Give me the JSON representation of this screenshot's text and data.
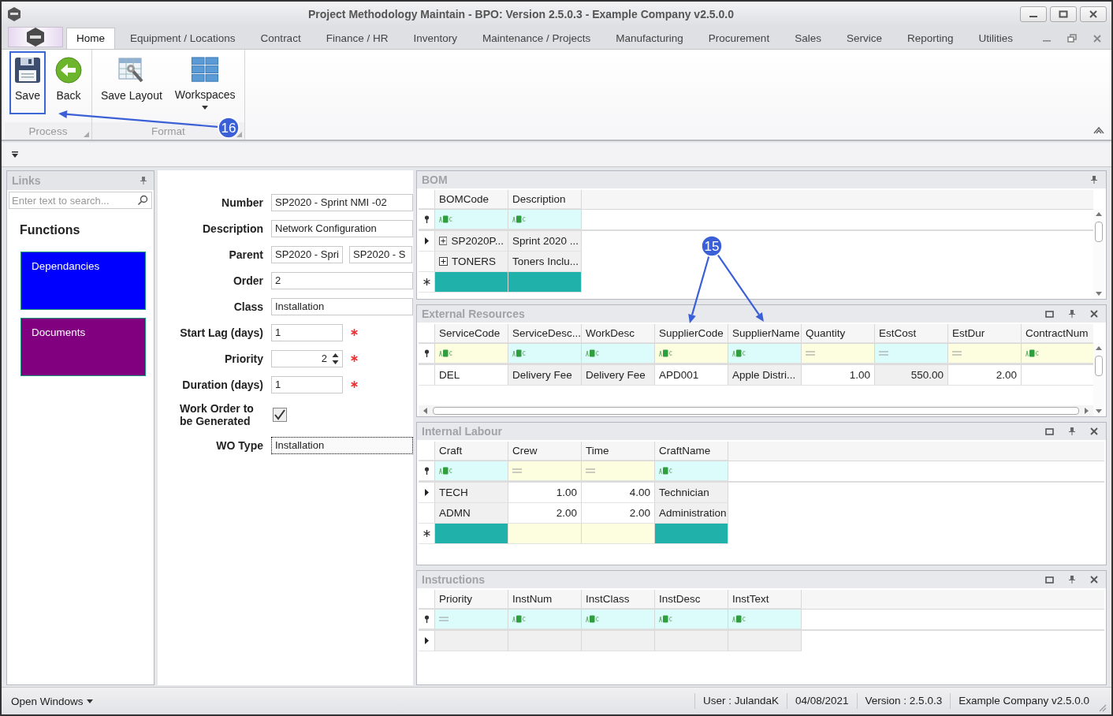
{
  "window": {
    "title": "Project Methodology Maintain - BPO: Version 2.5.0.3 - Example Company v2.5.0.0"
  },
  "tabs": [
    {
      "label": "Home",
      "selected": true
    },
    {
      "label": "Equipment / Locations",
      "selected": false
    },
    {
      "label": "Contract",
      "selected": false
    },
    {
      "label": "Finance / HR",
      "selected": false
    },
    {
      "label": "Inventory",
      "selected": false
    },
    {
      "label": "Maintenance / Projects",
      "selected": false
    },
    {
      "label": "Manufacturing",
      "selected": false
    },
    {
      "label": "Procurement",
      "selected": false
    },
    {
      "label": "Sales",
      "selected": false
    },
    {
      "label": "Service",
      "selected": false
    },
    {
      "label": "Reporting",
      "selected": false
    },
    {
      "label": "Utilities",
      "selected": false
    }
  ],
  "ribbon": {
    "groups": [
      {
        "label": "Process",
        "buttons": [
          {
            "label": "Save",
            "kind": "save",
            "highlighted": true,
            "dropdown": false
          },
          {
            "label": "Back",
            "kind": "back",
            "highlighted": false,
            "dropdown": false
          }
        ]
      },
      {
        "label": "Format",
        "buttons": [
          {
            "label": "Save Layout",
            "kind": "layout",
            "highlighted": false,
            "dropdown": false
          },
          {
            "label": "Workspaces",
            "kind": "workspaces",
            "highlighted": false,
            "dropdown": true
          }
        ]
      }
    ]
  },
  "links": {
    "title": "Links",
    "search": {
      "placeholder": "Enter text to search..."
    },
    "heading": "Functions",
    "items": [
      {
        "label": "Dependancies",
        "color": "#0000ff"
      },
      {
        "label": "Documents",
        "color": "#800080"
      }
    ]
  },
  "form": {
    "fields": [
      {
        "label": "Number",
        "kind": "text",
        "value": "SP2020 - Sprint NMI -02",
        "focused": false
      },
      {
        "label": "Description",
        "kind": "text",
        "value": "Network Configuration",
        "focused": false
      },
      {
        "label": "Parent",
        "kind": "pair",
        "values": [
          "SP2020 - Spri",
          "SP2020 - S"
        ],
        "focused": false
      },
      {
        "label": "Order",
        "kind": "text",
        "value": "2",
        "focused": false
      },
      {
        "label": "Class",
        "kind": "text",
        "value": "Installation",
        "focused": false
      },
      {
        "label": "Start Lag (days)",
        "kind": "number",
        "value": "1",
        "required": true,
        "focused": false
      },
      {
        "label": "Priority",
        "kind": "spin",
        "value": "2",
        "required": true,
        "focused": false
      },
      {
        "label": "Duration (days)",
        "kind": "number",
        "value": "1",
        "required": true,
        "focused": false
      },
      {
        "label": "Work Order to be Generated",
        "kind": "check",
        "checked": true
      },
      {
        "label": "WO Type",
        "kind": "text",
        "value": "Installation",
        "focused": true
      }
    ]
  },
  "panels": [
    {
      "title": "BOM",
      "controls": [
        {
          "kind": "pin"
        }
      ],
      "vertical_scroll": true,
      "horizontal_scroll": false,
      "new_row": true,
      "columns": [
        {
          "label": "BOMCode",
          "kind": "text",
          "color": "#dcfbfb",
          "editable": false
        },
        {
          "label": "Description",
          "kind": "text",
          "color": "#dcfbfb",
          "editable": false
        }
      ],
      "rows": [
        {
          "current": true,
          "expandable": true,
          "cells": [
            "SP2020P...",
            "Sprint 2020 ..."
          ]
        },
        {
          "current": false,
          "expandable": true,
          "cells": [
            "TONERS",
            "Toners Inclu..."
          ]
        }
      ]
    },
    {
      "title": "External Resources",
      "controls": [
        {
          "kind": "restore"
        },
        {
          "kind": "pin"
        },
        {
          "kind": "close"
        }
      ],
      "vertical_scroll": true,
      "horizontal_scroll": true,
      "new_row": false,
      "columns": [
        {
          "label": "ServiceCode",
          "kind": "text",
          "color": "#fdfde0",
          "editable": true
        },
        {
          "label": "ServiceDesc...",
          "kind": "text",
          "color": "#dcfbfb",
          "editable": false
        },
        {
          "label": "WorkDesc",
          "kind": "text",
          "color": "#dcfbfb",
          "editable": false
        },
        {
          "label": "SupplierCode",
          "kind": "text",
          "color": "#fdfde0",
          "editable": true
        },
        {
          "label": "SupplierName",
          "kind": "text",
          "color": "#dcfbfb",
          "editable": false
        },
        {
          "label": "Quantity",
          "kind": "number",
          "color": "#fdfde0",
          "editable": true
        },
        {
          "label": "EstCost",
          "kind": "number",
          "color": "#dcfbfb",
          "editable": false
        },
        {
          "label": "EstDur",
          "kind": "number",
          "color": "#fdfde0",
          "editable": true
        },
        {
          "label": "ContractNum",
          "kind": "text",
          "color": "#fdfde0",
          "editable": true
        }
      ],
      "rows": [
        {
          "current": false,
          "expandable": false,
          "cells": [
            "DEL",
            "Delivery Fee",
            "Delivery Fee",
            "APD001",
            "Apple Distri...",
            "1.00",
            "550.00",
            "2.00",
            null
          ]
        }
      ]
    },
    {
      "title": "Internal Labour",
      "controls": [
        {
          "kind": "restore"
        },
        {
          "kind": "pin"
        },
        {
          "kind": "close"
        }
      ],
      "vertical_scroll": false,
      "horizontal_scroll": false,
      "new_row": true,
      "columns": [
        {
          "label": "Craft",
          "kind": "text",
          "color": "#dcfbfb",
          "editable": false
        },
        {
          "label": "Crew",
          "kind": "number",
          "color": "#fdfde0",
          "editable": true
        },
        {
          "label": "Time",
          "kind": "number",
          "color": "#fdfde0",
          "editable": true
        },
        {
          "label": "CraftName",
          "kind": "text",
          "color": "#dcfbfb",
          "editable": false
        }
      ],
      "rows": [
        {
          "current": true,
          "expandable": false,
          "cells": [
            "TECH",
            "1.00",
            "4.00",
            "Technician"
          ]
        },
        {
          "current": false,
          "expandable": false,
          "cells": [
            "ADMN",
            "2.00",
            "2.00",
            "Administration"
          ]
        }
      ]
    },
    {
      "title": "Instructions",
      "controls": [
        {
          "kind": "restore"
        },
        {
          "kind": "pin"
        },
        {
          "kind": "close"
        }
      ],
      "vertical_scroll": false,
      "horizontal_scroll": false,
      "new_row": false,
      "columns": [
        {
          "label": "Priority",
          "kind": "number",
          "color": "#dcfbfb",
          "editable": false
        },
        {
          "label": "InstNum",
          "kind": "text",
          "color": "#dcfbfb",
          "editable": false
        },
        {
          "label": "InstClass",
          "kind": "text",
          "color": "#dcfbfb",
          "editable": false
        },
        {
          "label": "InstDesc",
          "kind": "text",
          "color": "#dcfbfb",
          "editable": false
        },
        {
          "label": "InstText",
          "kind": "text",
          "color": "#dcfbfb",
          "editable": false
        }
      ],
      "rows": [
        {
          "current": true,
          "expandable": false,
          "cells": [
            null,
            null,
            null,
            null,
            null
          ]
        }
      ]
    }
  ],
  "status_bar": {
    "menu": "Open Windows",
    "items": [
      "User : JulandaK",
      "04/08/2021",
      "Version : 2.5.0.3",
      "Example Company v2.5.0.0"
    ]
  },
  "annotations": [
    {
      "label": "16"
    },
    {
      "label": "15"
    }
  ]
}
